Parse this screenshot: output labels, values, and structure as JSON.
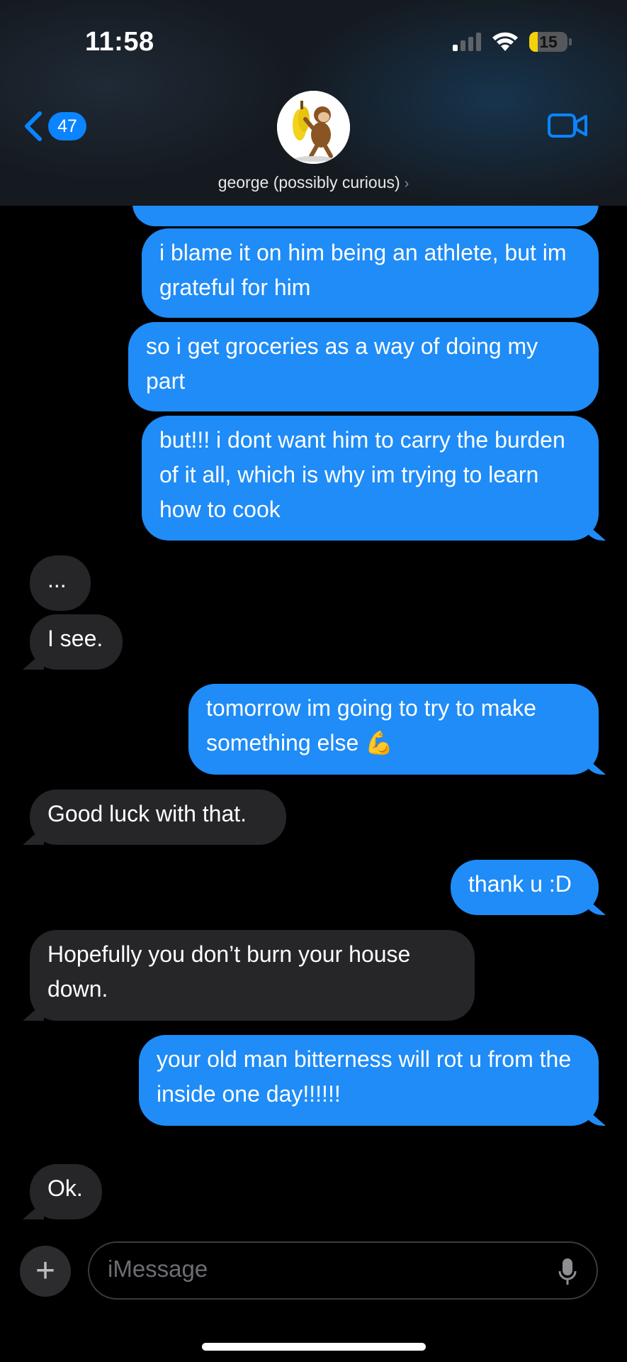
{
  "status_bar": {
    "time": "11:58",
    "battery": "15",
    "battery_level_percent": 15
  },
  "header": {
    "back_count": "47",
    "contact_name": "george (possibly curious)",
    "icons": [
      "back-chevron-icon",
      "avatar",
      "video-call-icon"
    ]
  },
  "colors": {
    "sent": "#1f8cf7",
    "received": "#262629",
    "accent": "#0a84ff",
    "battery": "#f5d10a"
  },
  "messages": [
    {
      "from": "me",
      "text": "i blame it on him being an athlete, but im grateful for him"
    },
    {
      "from": "me",
      "text": "so i get groceries as a way of doing my part"
    },
    {
      "from": "me",
      "text": "but!!! i dont want him to carry the burden of it all, which is why im trying to learn how to cook"
    },
    {
      "from": "them",
      "text": "..."
    },
    {
      "from": "them",
      "text": "I see."
    },
    {
      "from": "me",
      "text": "tomorrow im going to try to make something else 💪"
    },
    {
      "from": "them",
      "text": "Good luck with that."
    },
    {
      "from": "me",
      "text": "thank u :D"
    },
    {
      "from": "them",
      "text": "Hopefully you don’t burn your house down."
    },
    {
      "from": "me",
      "text": "your old man bitterness will rot u from the inside one day!!!!!!"
    },
    {
      "from": "them",
      "text": "Ok."
    }
  ],
  "composer": {
    "placeholder": "iMessage"
  }
}
